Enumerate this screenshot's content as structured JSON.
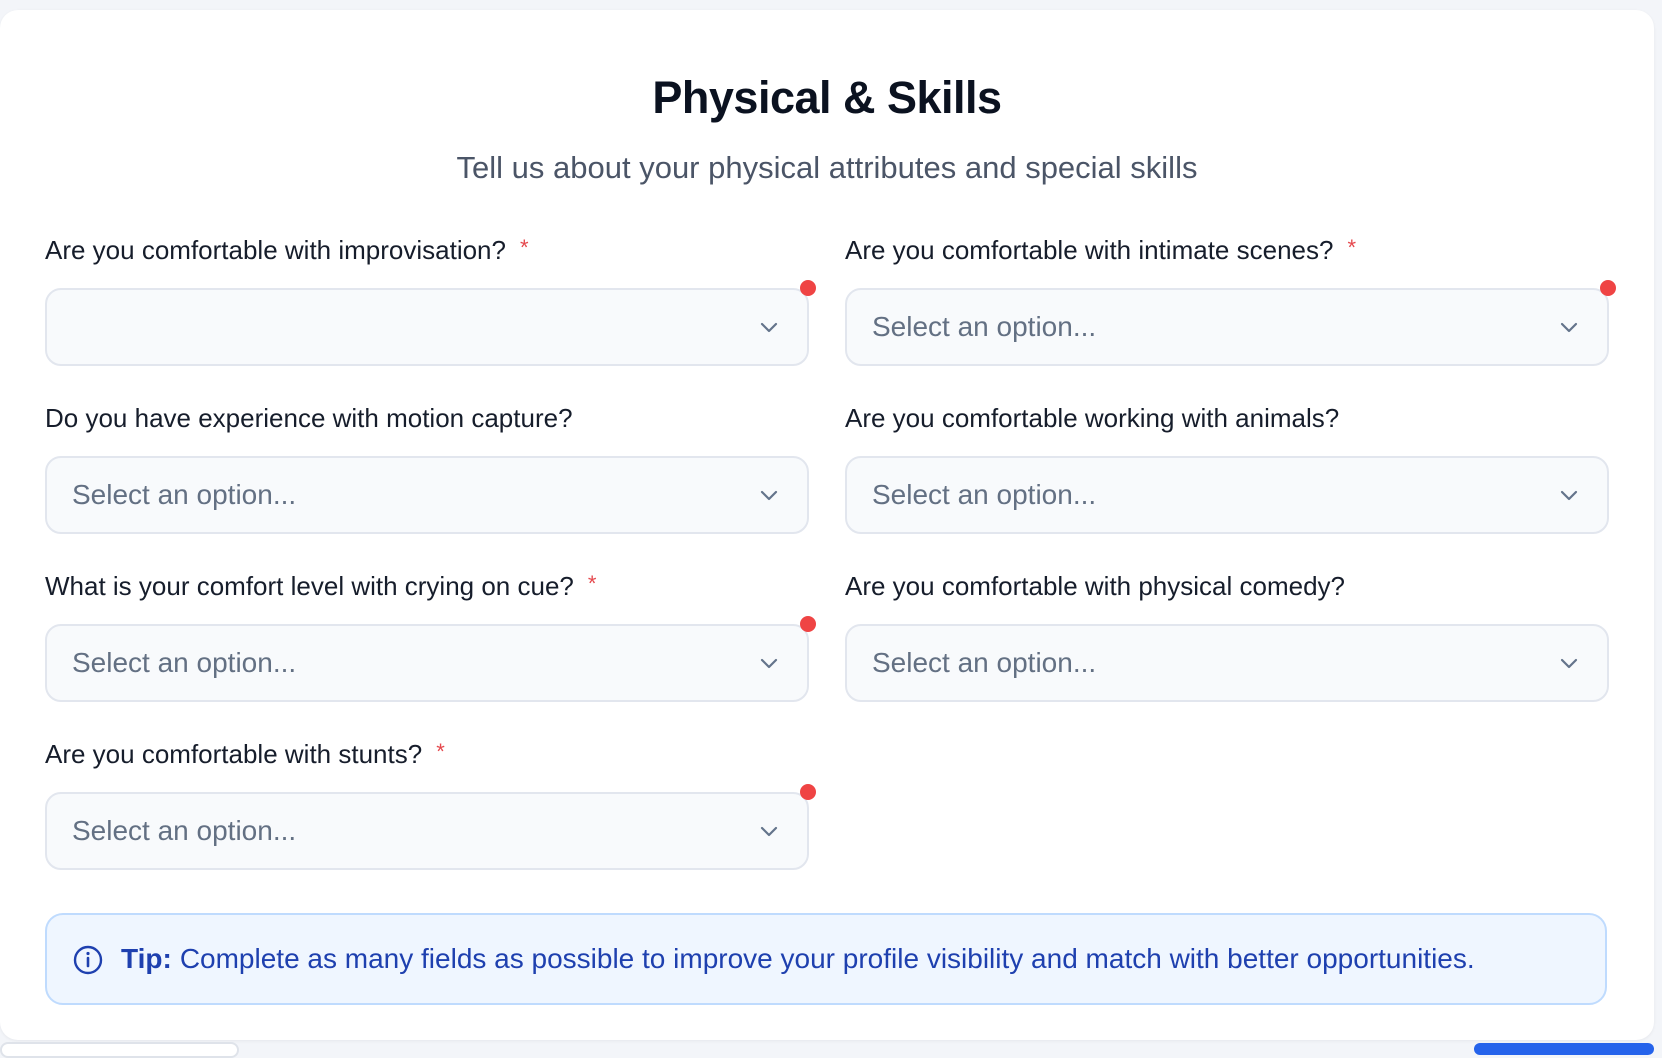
{
  "header": {
    "title": "Physical & Skills",
    "subtitle": "Tell us about your physical attributes and special skills"
  },
  "fields": [
    {
      "label": "Are you comfortable with improvisation?",
      "required": true,
      "value": "",
      "placeholder": ""
    },
    {
      "label": "Are you comfortable with intimate scenes?",
      "required": true,
      "value": "Select an option..."
    },
    {
      "label": "Do you have experience with motion capture?",
      "required": false,
      "value": "Select an option..."
    },
    {
      "label": "Are you comfortable working with animals?",
      "required": false,
      "value": "Select an option..."
    },
    {
      "label": "What is your comfort level with crying on cue?",
      "required": true,
      "value": "Select an option..."
    },
    {
      "label": "Are you comfortable with physical comedy?",
      "required": false,
      "value": "Select an option..."
    },
    {
      "label": "Are you comfortable with stunts?",
      "required": true,
      "value": "Select an option..."
    }
  ],
  "required_mark": "*",
  "tip": {
    "icon": "info-icon",
    "prefix": "Tip:",
    "text": "Complete as many fields as possible to improve your profile visibility and match with better opportunities."
  },
  "colors": {
    "accent": "#2563eb",
    "error": "#ef4444",
    "tip_text": "#1e40af",
    "tip_bg": "#eff6ff"
  }
}
